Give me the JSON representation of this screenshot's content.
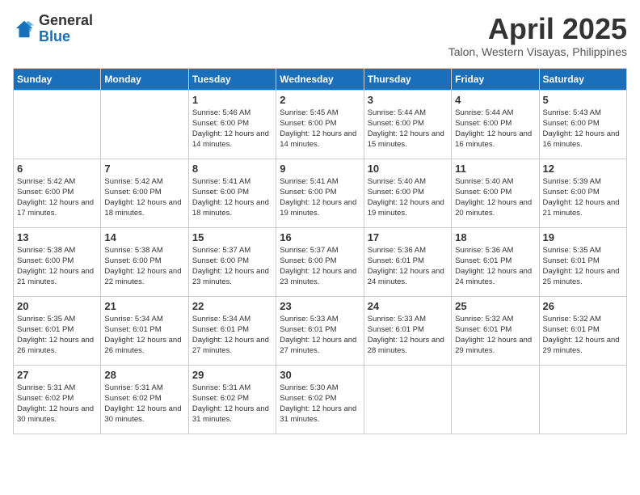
{
  "header": {
    "logo_general": "General",
    "logo_blue": "Blue",
    "month_title": "April 2025",
    "location": "Talon, Western Visayas, Philippines"
  },
  "weekdays": [
    "Sunday",
    "Monday",
    "Tuesday",
    "Wednesday",
    "Thursday",
    "Friday",
    "Saturday"
  ],
  "weeks": [
    [
      {
        "day": "",
        "info": ""
      },
      {
        "day": "",
        "info": ""
      },
      {
        "day": "1",
        "info": "Sunrise: 5:46 AM\nSunset: 6:00 PM\nDaylight: 12 hours and 14 minutes."
      },
      {
        "day": "2",
        "info": "Sunrise: 5:45 AM\nSunset: 6:00 PM\nDaylight: 12 hours and 14 minutes."
      },
      {
        "day": "3",
        "info": "Sunrise: 5:44 AM\nSunset: 6:00 PM\nDaylight: 12 hours and 15 minutes."
      },
      {
        "day": "4",
        "info": "Sunrise: 5:44 AM\nSunset: 6:00 PM\nDaylight: 12 hours and 16 minutes."
      },
      {
        "day": "5",
        "info": "Sunrise: 5:43 AM\nSunset: 6:00 PM\nDaylight: 12 hours and 16 minutes."
      }
    ],
    [
      {
        "day": "6",
        "info": "Sunrise: 5:42 AM\nSunset: 6:00 PM\nDaylight: 12 hours and 17 minutes."
      },
      {
        "day": "7",
        "info": "Sunrise: 5:42 AM\nSunset: 6:00 PM\nDaylight: 12 hours and 18 minutes."
      },
      {
        "day": "8",
        "info": "Sunrise: 5:41 AM\nSunset: 6:00 PM\nDaylight: 12 hours and 18 minutes."
      },
      {
        "day": "9",
        "info": "Sunrise: 5:41 AM\nSunset: 6:00 PM\nDaylight: 12 hours and 19 minutes."
      },
      {
        "day": "10",
        "info": "Sunrise: 5:40 AM\nSunset: 6:00 PM\nDaylight: 12 hours and 19 minutes."
      },
      {
        "day": "11",
        "info": "Sunrise: 5:40 AM\nSunset: 6:00 PM\nDaylight: 12 hours and 20 minutes."
      },
      {
        "day": "12",
        "info": "Sunrise: 5:39 AM\nSunset: 6:00 PM\nDaylight: 12 hours and 21 minutes."
      }
    ],
    [
      {
        "day": "13",
        "info": "Sunrise: 5:38 AM\nSunset: 6:00 PM\nDaylight: 12 hours and 21 minutes."
      },
      {
        "day": "14",
        "info": "Sunrise: 5:38 AM\nSunset: 6:00 PM\nDaylight: 12 hours and 22 minutes."
      },
      {
        "day": "15",
        "info": "Sunrise: 5:37 AM\nSunset: 6:00 PM\nDaylight: 12 hours and 23 minutes."
      },
      {
        "day": "16",
        "info": "Sunrise: 5:37 AM\nSunset: 6:00 PM\nDaylight: 12 hours and 23 minutes."
      },
      {
        "day": "17",
        "info": "Sunrise: 5:36 AM\nSunset: 6:01 PM\nDaylight: 12 hours and 24 minutes."
      },
      {
        "day": "18",
        "info": "Sunrise: 5:36 AM\nSunset: 6:01 PM\nDaylight: 12 hours and 24 minutes."
      },
      {
        "day": "19",
        "info": "Sunrise: 5:35 AM\nSunset: 6:01 PM\nDaylight: 12 hours and 25 minutes."
      }
    ],
    [
      {
        "day": "20",
        "info": "Sunrise: 5:35 AM\nSunset: 6:01 PM\nDaylight: 12 hours and 26 minutes."
      },
      {
        "day": "21",
        "info": "Sunrise: 5:34 AM\nSunset: 6:01 PM\nDaylight: 12 hours and 26 minutes."
      },
      {
        "day": "22",
        "info": "Sunrise: 5:34 AM\nSunset: 6:01 PM\nDaylight: 12 hours and 27 minutes."
      },
      {
        "day": "23",
        "info": "Sunrise: 5:33 AM\nSunset: 6:01 PM\nDaylight: 12 hours and 27 minutes."
      },
      {
        "day": "24",
        "info": "Sunrise: 5:33 AM\nSunset: 6:01 PM\nDaylight: 12 hours and 28 minutes."
      },
      {
        "day": "25",
        "info": "Sunrise: 5:32 AM\nSunset: 6:01 PM\nDaylight: 12 hours and 29 minutes."
      },
      {
        "day": "26",
        "info": "Sunrise: 5:32 AM\nSunset: 6:01 PM\nDaylight: 12 hours and 29 minutes."
      }
    ],
    [
      {
        "day": "27",
        "info": "Sunrise: 5:31 AM\nSunset: 6:02 PM\nDaylight: 12 hours and 30 minutes."
      },
      {
        "day": "28",
        "info": "Sunrise: 5:31 AM\nSunset: 6:02 PM\nDaylight: 12 hours and 30 minutes."
      },
      {
        "day": "29",
        "info": "Sunrise: 5:31 AM\nSunset: 6:02 PM\nDaylight: 12 hours and 31 minutes."
      },
      {
        "day": "30",
        "info": "Sunrise: 5:30 AM\nSunset: 6:02 PM\nDaylight: 12 hours and 31 minutes."
      },
      {
        "day": "",
        "info": ""
      },
      {
        "day": "",
        "info": ""
      },
      {
        "day": "",
        "info": ""
      }
    ]
  ]
}
